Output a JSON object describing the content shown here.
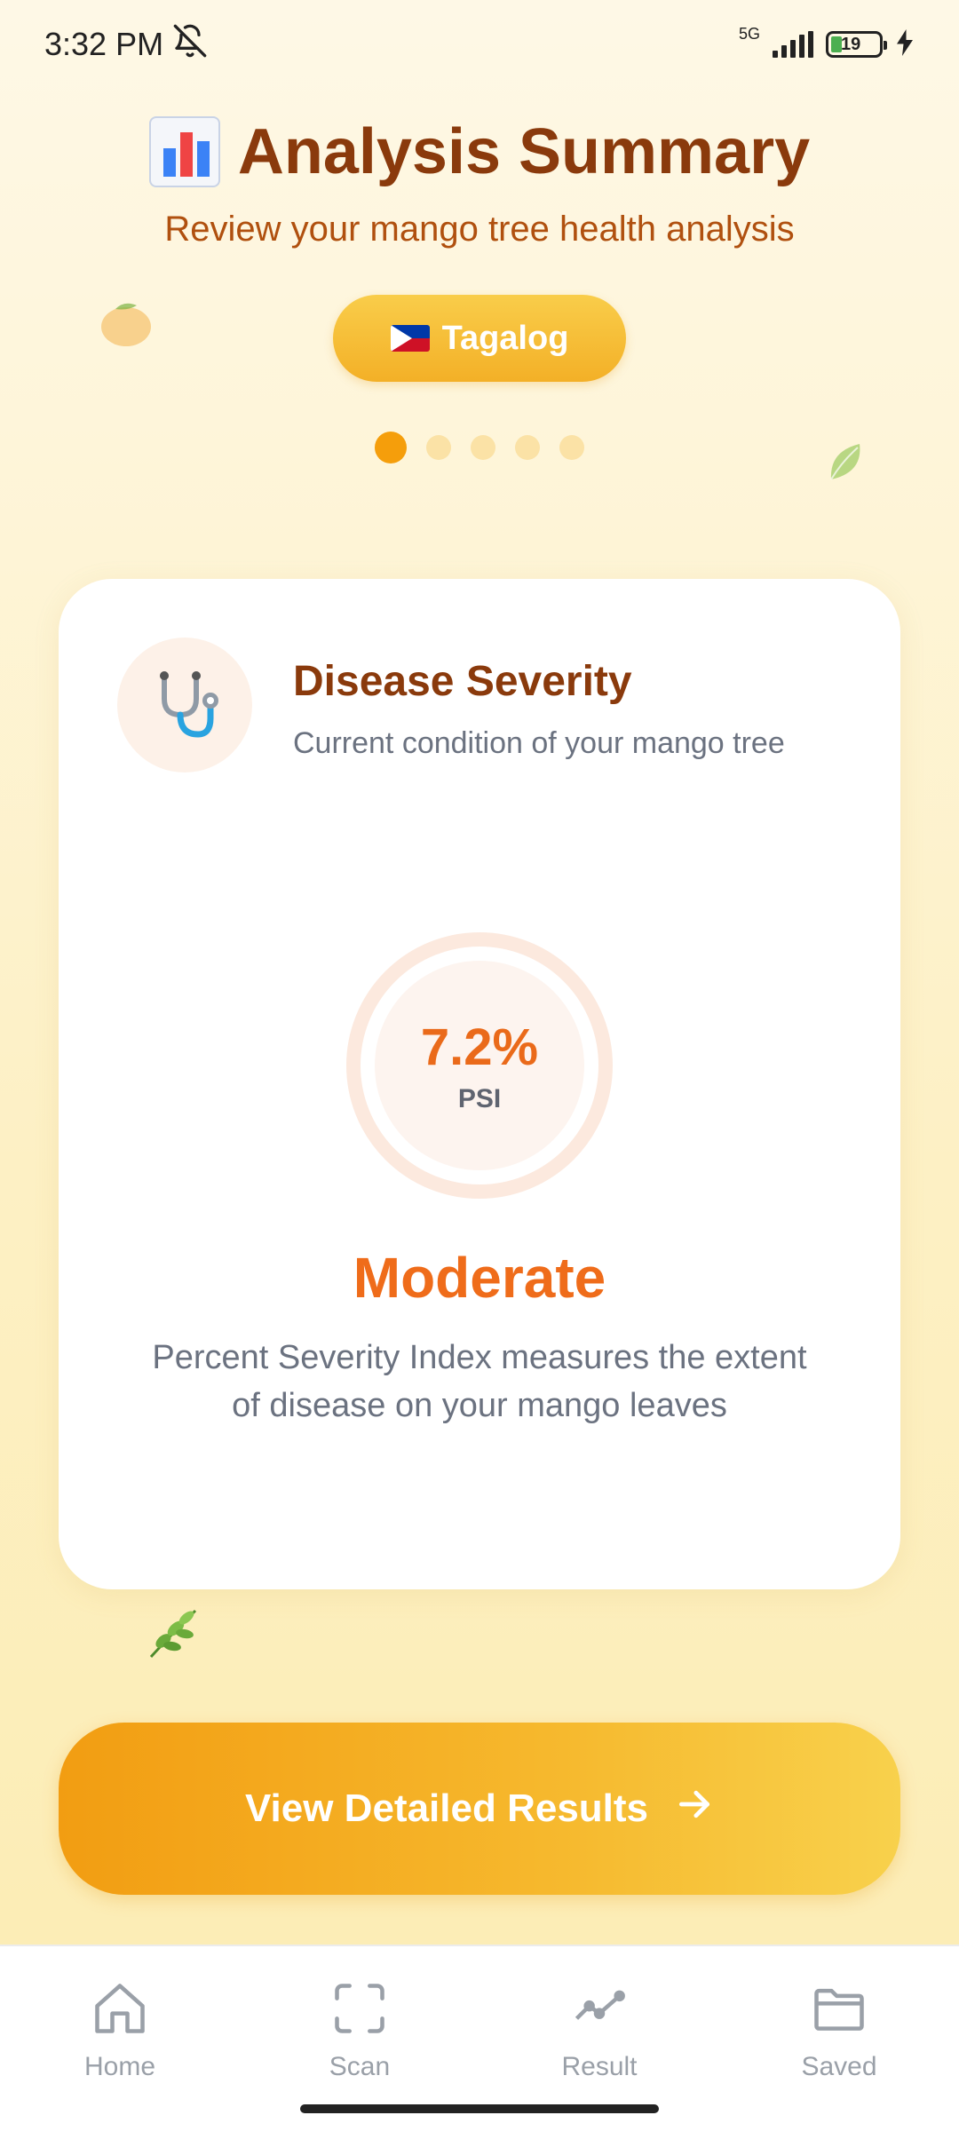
{
  "status_bar": {
    "time": "3:32 PM",
    "network": "5G",
    "battery": "19",
    "icons": [
      "bell-off-icon",
      "signal-icon",
      "battery-icon",
      "charging-icon"
    ]
  },
  "header": {
    "title": "Analysis Summary",
    "subtitle": "Review your mango tree health analysis",
    "icon": "bar-chart-icon"
  },
  "language_button": {
    "label": "Tagalog",
    "icon": "philippines-flag-icon"
  },
  "pagination": {
    "total": 5,
    "active_index": 0
  },
  "card": {
    "icon": "stethoscope-icon",
    "title": "Disease Severity",
    "subtitle": "Current condition of your mango tree",
    "psi_value": "7.2%",
    "psi_label": "PSI",
    "severity": "Moderate",
    "description": "Percent Severity Index measures the extent of disease on your mango leaves"
  },
  "cta": {
    "label": "View Detailed Results",
    "icon": "arrow-right-icon"
  },
  "nav": {
    "items": [
      {
        "label": "Home",
        "icon": "home-icon"
      },
      {
        "label": "Scan",
        "icon": "scan-icon"
      },
      {
        "label": "Result",
        "icon": "trend-line-icon"
      },
      {
        "label": "Saved",
        "icon": "folder-icon"
      }
    ]
  },
  "colors": {
    "title": "#8a3a0c",
    "accent": "#f59e0b",
    "severity": "#ef6c1a"
  }
}
